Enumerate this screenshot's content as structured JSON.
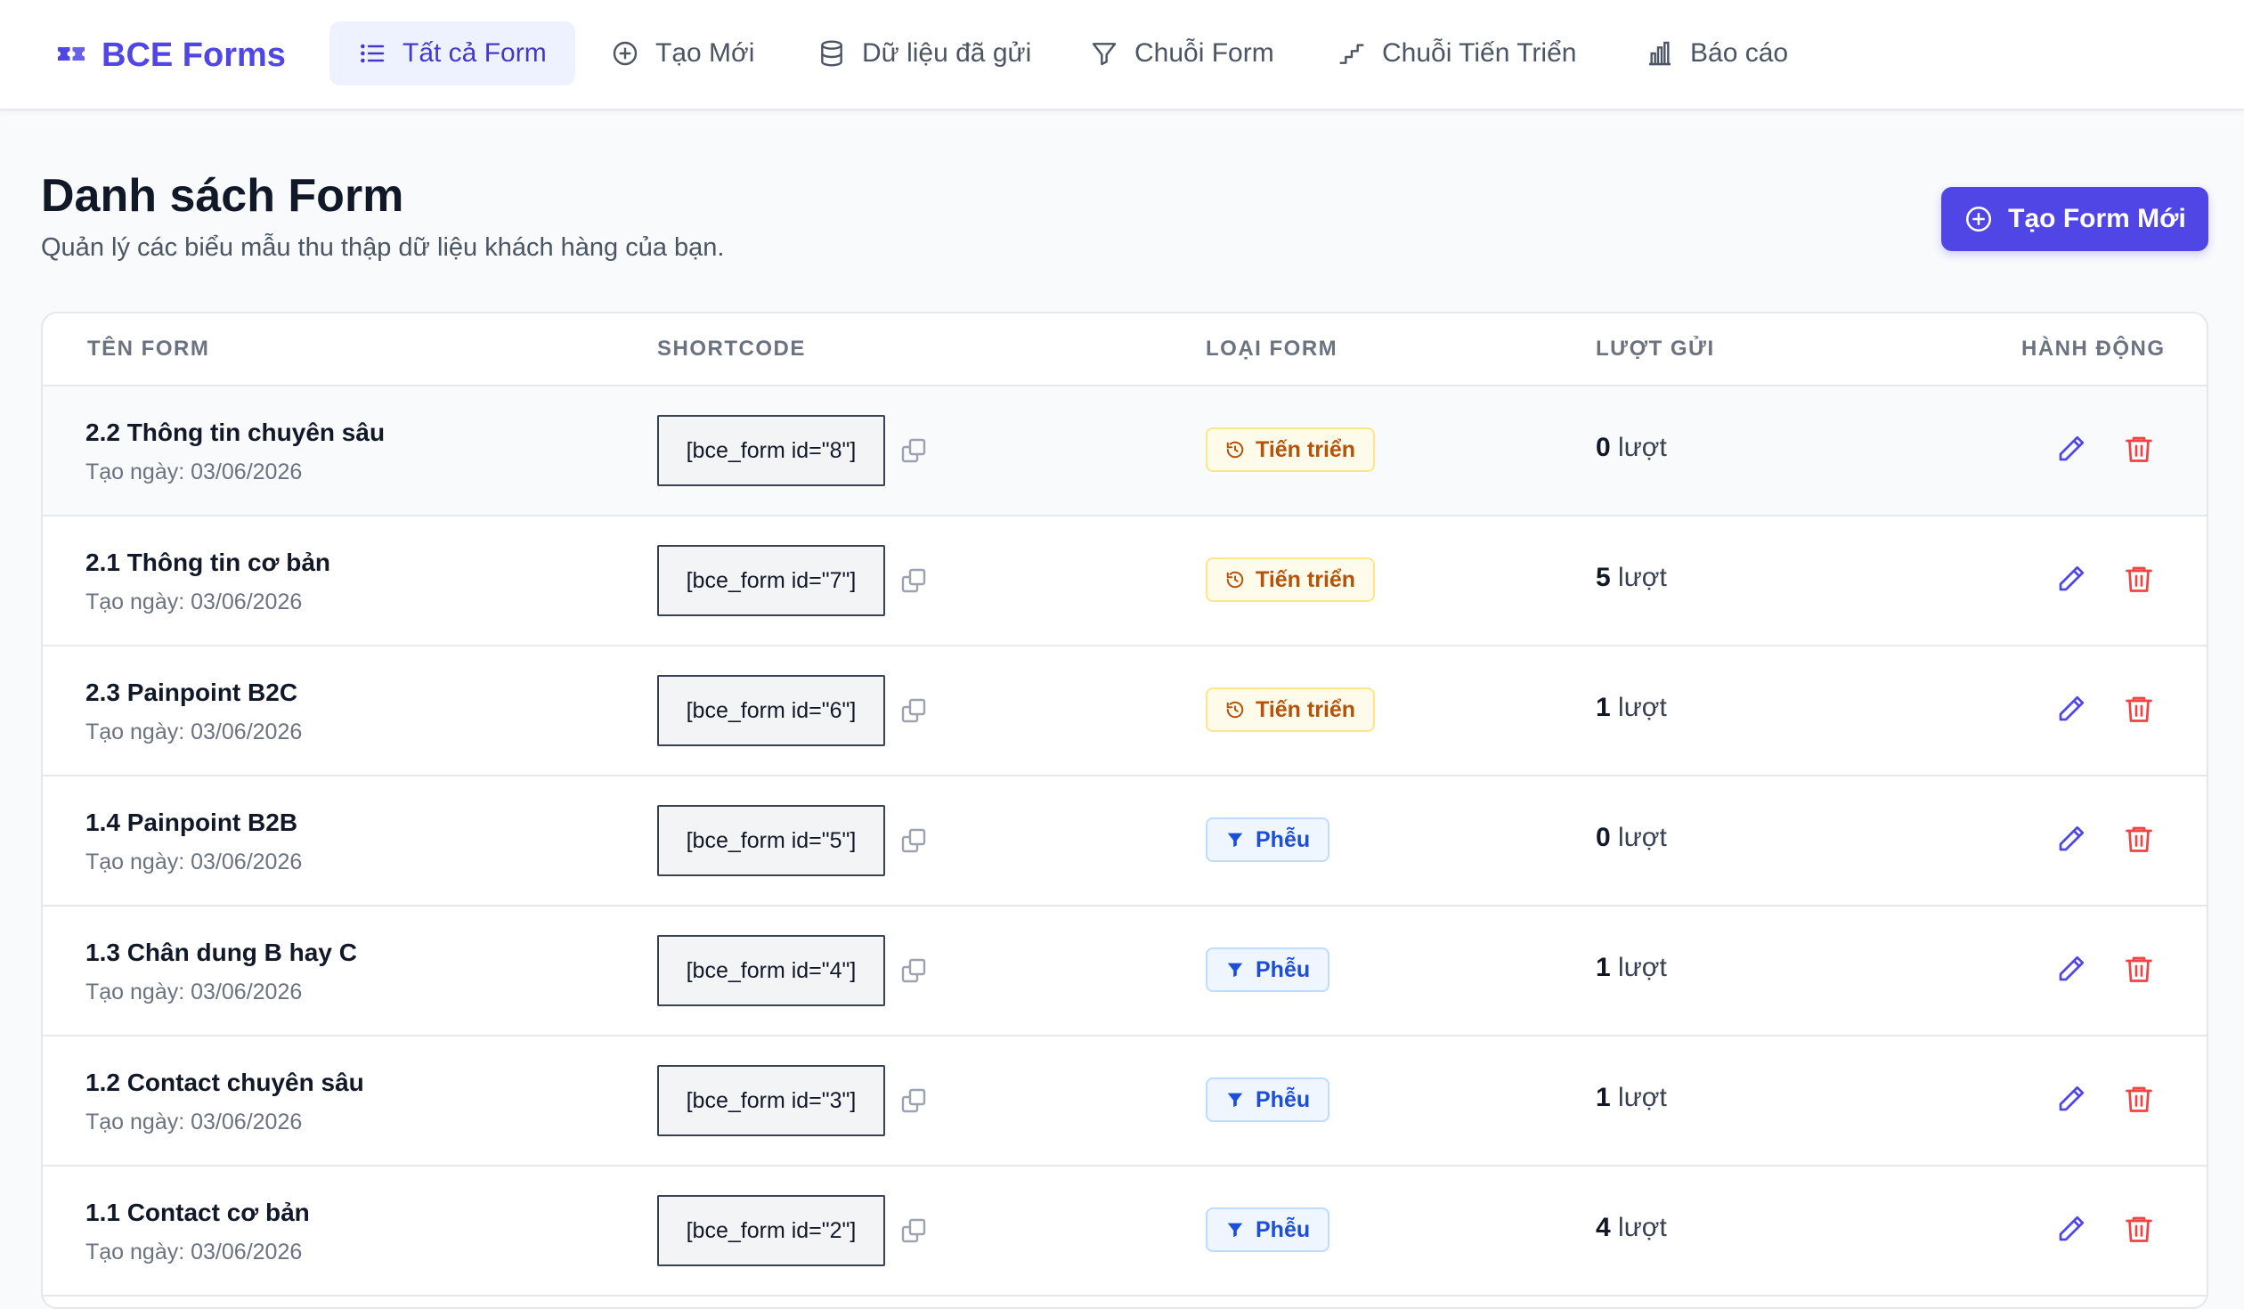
{
  "brand": {
    "name": "BCE Forms",
    "icon": "ticket-icon"
  },
  "nav": {
    "all_forms": "Tất cả Form",
    "create_new": "Tạo Mới",
    "submitted_data": "Dữ liệu đã gửi",
    "form_chain": "Chuỗi Form",
    "progress_chain": "Chuỗi Tiến Triển",
    "reports": "Báo cáo"
  },
  "header": {
    "title": "Danh sách Form",
    "subtitle": "Quản lý các biểu mẫu thu thập dữ liệu khách hàng của bạn.",
    "create_button": "Tạo Form Mới"
  },
  "table": {
    "columns": {
      "name": "TÊN FORM",
      "shortcode": "SHORTCODE",
      "type": "LOẠI FORM",
      "submissions": "LƯỢT GỬI",
      "actions": "HÀNH ĐỘNG"
    },
    "rows": [
      {
        "name": "2.2 Thông tin chuyên sâu",
        "date": "Tạo ngày: 03/06/2026",
        "shortcode": "[bce_form id=\"8\"]",
        "type": "Tiến triển",
        "count": "0",
        "unit": " lượt"
      },
      {
        "name": "2.1 Thông tin cơ bản",
        "date": "Tạo ngày: 03/06/2026",
        "shortcode": "[bce_form id=\"7\"]",
        "type": "Tiến triển",
        "count": "5",
        "unit": " lượt"
      },
      {
        "name": "2.3 Painpoint B2C",
        "date": "Tạo ngày: 03/06/2026",
        "shortcode": "[bce_form id=\"6\"]",
        "type": "Tiến triển",
        "count": "1",
        "unit": " lượt"
      },
      {
        "name": "1.4 Painpoint B2B",
        "date": "Tạo ngày: 03/06/2026",
        "shortcode": "[bce_form id=\"5\"]",
        "type": "Phễu",
        "count": "0",
        "unit": " lượt"
      },
      {
        "name": "1.3 Chân dung B hay C",
        "date": "Tạo ngày: 03/06/2026",
        "shortcode": "[bce_form id=\"4\"]",
        "type": "Phễu",
        "count": "1",
        "unit": " lượt"
      },
      {
        "name": "1.2 Contact chuyên sâu",
        "date": "Tạo ngày: 03/06/2026",
        "shortcode": "[bce_form id=\"3\"]",
        "type": "Phễu",
        "count": "1",
        "unit": " lượt"
      },
      {
        "name": "1.1 Contact cơ bản",
        "date": "Tạo ngày: 03/06/2026",
        "shortcode": "[bce_form id=\"2\"]",
        "type": "Phễu",
        "count": "4",
        "unit": " lượt"
      }
    ]
  },
  "colors": {
    "accent": "#4f46e5",
    "progress_badge": "#b45309",
    "funnel_badge": "#1d4ed8",
    "delete": "#ef4444"
  }
}
